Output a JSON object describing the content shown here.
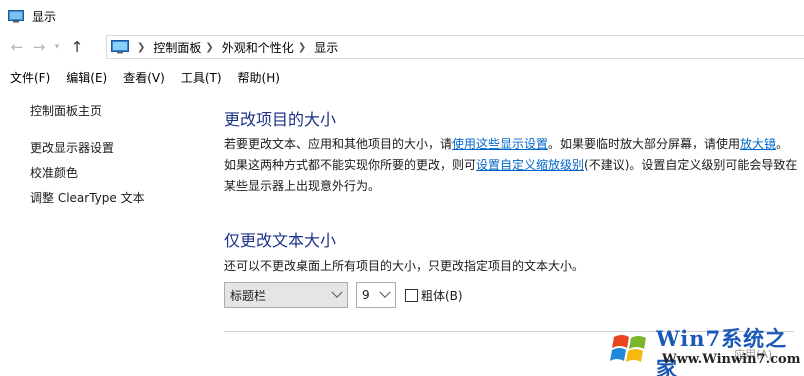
{
  "window": {
    "title": "显示"
  },
  "nav": {
    "back_icon": "back-arrow-icon",
    "forward_icon": "forward-arrow-icon",
    "up_icon": "up-arrow-icon",
    "breadcrumb": [
      "控制面板",
      "外观和个性化",
      "显示"
    ]
  },
  "menu": {
    "items": [
      "文件(F)",
      "编辑(E)",
      "查看(V)",
      "工具(T)",
      "帮助(H)"
    ]
  },
  "sidebar": {
    "home": "控制面板主页",
    "links": [
      "更改显示器设置",
      "校准颜色",
      "调整 ClearType 文本"
    ]
  },
  "main": {
    "heading": "更改项目的大小",
    "para_1": "若要更改文本、应用和其他项目的大小，请",
    "link_display_settings": "使用这些显示设置",
    "para_2": "。如果要临时放大部分屏幕，请使用",
    "link_magnifier": "放大镜",
    "para_3": "。如果这两种方式都不能实现你所要的更改，则可",
    "link_custom_scaling": "设置自定义缩放级别",
    "para_4": "(不建议)。设置自定义级别可能会导致在某些显示器上出现意外行为。",
    "heading_2": "仅更改文本大小",
    "para_text_only": "还可以不更改桌面上所有项目的大小，只更改指定项目的文本大小。"
  },
  "controls": {
    "item_select_value": "标题栏",
    "size_select_value": "9",
    "bold_label": "粗体(B)",
    "bold_checked": false
  },
  "watermark": {
    "brand": "Win7系统之家",
    "url": "Www.Winwin7.com",
    "apply_label": "应用(A)"
  },
  "colors": {
    "heading": "#1e3287",
    "link": "#0066cc",
    "watermark_brand": "#1b58b8"
  }
}
